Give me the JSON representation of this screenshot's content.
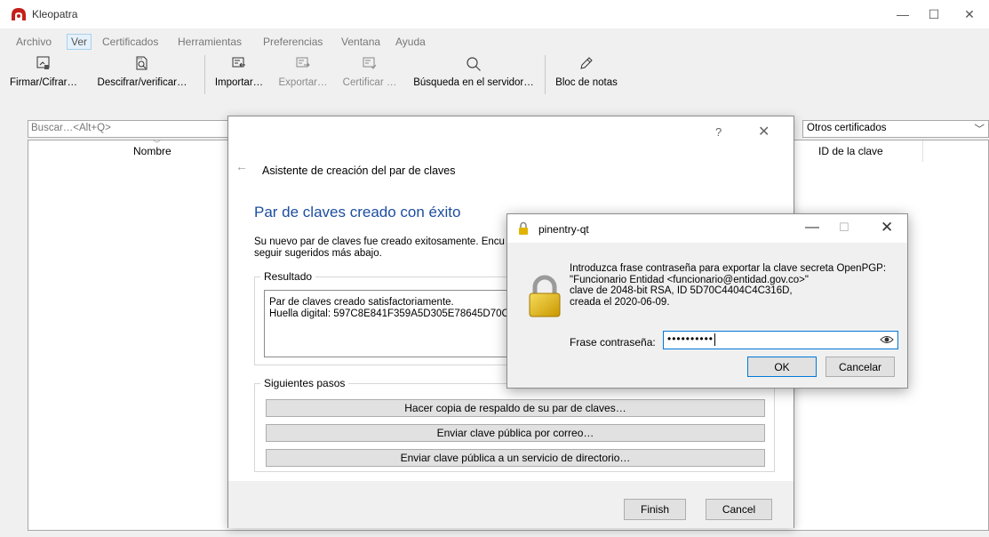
{
  "window": {
    "title": "Kleopatra"
  },
  "menu": [
    "Archivo",
    "Ver",
    "Certificados",
    "Herramientas",
    "Preferencias",
    "Ventana",
    "Ayuda"
  ],
  "menu_active": "Ver",
  "toolbar": [
    {
      "label": "Firmar/Cifrar…",
      "icon": "sign-encrypt-icon",
      "enabled": true
    },
    {
      "label": "Descifrar/verificar…",
      "icon": "decrypt-verify-icon",
      "enabled": true
    },
    {
      "label": "Importar…",
      "icon": "import-icon",
      "enabled": true
    },
    {
      "label": "Exportar…",
      "icon": "export-icon",
      "enabled": false
    },
    {
      "label": "Certificar …",
      "icon": "certify-icon",
      "enabled": false
    },
    {
      "label": "Búsqueda en el servidor…",
      "icon": "search-server-icon",
      "enabled": true
    },
    {
      "label": "Bloc de notas",
      "icon": "notepad-icon",
      "enabled": true
    }
  ],
  "search": {
    "placeholder": "Buscar…<Alt+Q>"
  },
  "filter": {
    "selected": "Otros certificados"
  },
  "columns": [
    "Nombre",
    "ID de la clave"
  ],
  "wizard": {
    "help": "?",
    "title": "Asistente de creación del par de claves",
    "heading": "Par de claves creado con éxito",
    "text_line1": "Su nuevo par de claves fue creado exitosamente. Encu",
    "text_line2": "seguir sugeridos más abajo.",
    "result_title": "Resultado",
    "result_line1": "Par de claves creado satisfactoriamente.",
    "result_line2": "Huella digital: 597C8E841F359A5D305E78645D70C",
    "next_title": "Siguientes pasos",
    "buttons": [
      "Hacer copia de respaldo de su par de claves…",
      "Enviar clave pública por correo…",
      "Enviar clave pública a un servicio de directorio…"
    ],
    "finish": "Finish",
    "cancel": "Cancel"
  },
  "pinentry": {
    "title": "pinentry-qt",
    "desc_line1": "Introduzca frase contraseña para exportar la clave secreta OpenPGP:",
    "desc_line2": "\"Funcionario Entidad <funcionario@entidad.gov.co>\"",
    "desc_line3": "clave de 2048-bit RSA, ID 5D70C4404C4C316D,",
    "desc_line4": "creada el 2020-06-09.",
    "label": "Frase contraseña:",
    "masked_value": "••••••••••",
    "ok": "OK",
    "cancel": "Cancelar"
  },
  "colors": {
    "accent": "#0078d7",
    "heading": "#1d4ea0",
    "lock": "#e2b400"
  }
}
